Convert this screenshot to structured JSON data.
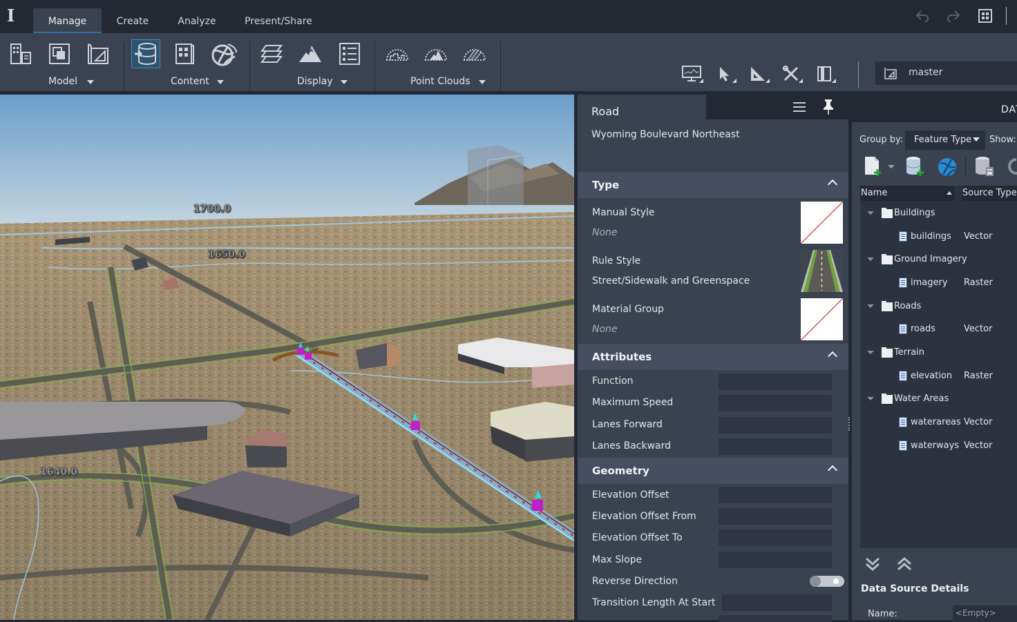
{
  "app": {
    "logo": "I"
  },
  "tabs": [
    {
      "label": "Manage",
      "active": true
    },
    {
      "label": "Create",
      "active": false
    },
    {
      "label": "Analyze",
      "active": false
    },
    {
      "label": "Present/Share",
      "active": false
    }
  ],
  "quick_access": [
    {
      "icon": "undo-icon"
    },
    {
      "icon": "redo-icon"
    },
    {
      "icon": "fullscreen-icon"
    }
  ],
  "ribbon": {
    "groups": [
      {
        "label": "Model",
        "buttons": [
          "model-buildings-icon",
          "model-layers-icon",
          "model-plan-icon"
        ]
      },
      {
        "label": "Content",
        "buttons": [
          "data-sources-icon",
          "asset-library-icon",
          "globe-icon"
        ],
        "selected": "data-sources-icon"
      },
      {
        "label": "Display",
        "buttons": [
          "layers-icon",
          "terrain-icon",
          "list-icon"
        ]
      },
      {
        "label": "Point Clouds",
        "buttons": [
          "pointcloud-buildings-icon",
          "pointcloud-terrain-icon",
          "pointcloud-lines-icon"
        ]
      }
    ],
    "tools": [
      "monitor-chart-icon",
      "select-arrow-icon",
      "measure-triangle-icon",
      "tools-icon",
      "bookmark-icon"
    ],
    "proposal": {
      "name": "master"
    }
  },
  "viewport": {
    "contour_labels": [
      "1700.0",
      "1650.0",
      "1640.0"
    ],
    "colors": {
      "sky_top": "#6d9fcc",
      "sky_bottom": "#c6d6e0",
      "ground": "#9a8a6e",
      "road_selected": "#7fb2d8",
      "node": "#c020c8",
      "handle": "#30d8e0"
    }
  },
  "properties": {
    "title": "Road",
    "subtitle": "Wyoming Boulevard Northeast",
    "sections": {
      "type": {
        "label": "Type",
        "manual_style": {
          "label": "Manual Style",
          "value": "None"
        },
        "rule_style": {
          "label": "Rule Style",
          "value": "Street/Sidewalk and Greenspace"
        },
        "material_group": {
          "label": "Material Group",
          "value": "None"
        }
      },
      "attributes": {
        "label": "Attributes",
        "fields": [
          "Function",
          "Maximum Speed",
          "Lanes Forward",
          "Lanes Backward"
        ]
      },
      "geometry": {
        "label": "Geometry",
        "fields": [
          "Elevation Offset",
          "Elevation Offset From",
          "Elevation Offset To",
          "Max Slope"
        ],
        "reverse_direction": {
          "label": "Reverse Direction",
          "value": false
        },
        "transition_start": {
          "label": "Transition Length At Start"
        }
      }
    }
  },
  "data_panel": {
    "header": "DATA",
    "group_by_label": "Group by:",
    "group_by_value": "Feature Type",
    "show_label": "Show:",
    "columns": {
      "name": "Name",
      "source_type": "Source Type"
    },
    "groups": [
      {
        "name": "Buildings",
        "items": [
          {
            "name": "buildings",
            "type": "Vector"
          }
        ]
      },
      {
        "name": "Ground Imagery",
        "items": [
          {
            "name": "imagery",
            "type": "Raster"
          }
        ]
      },
      {
        "name": "Roads",
        "items": [
          {
            "name": "roads",
            "type": "Vector"
          }
        ]
      },
      {
        "name": "Terrain",
        "items": [
          {
            "name": "elevation",
            "type": "Raster"
          }
        ]
      },
      {
        "name": "Water Areas",
        "items": [
          {
            "name": "waterareas",
            "type": "Vector"
          },
          {
            "name": "waterways",
            "type": "Vector"
          }
        ]
      }
    ],
    "details_title": "Data Source Details",
    "name_label": "Name:",
    "name_value": "<Empty>"
  }
}
